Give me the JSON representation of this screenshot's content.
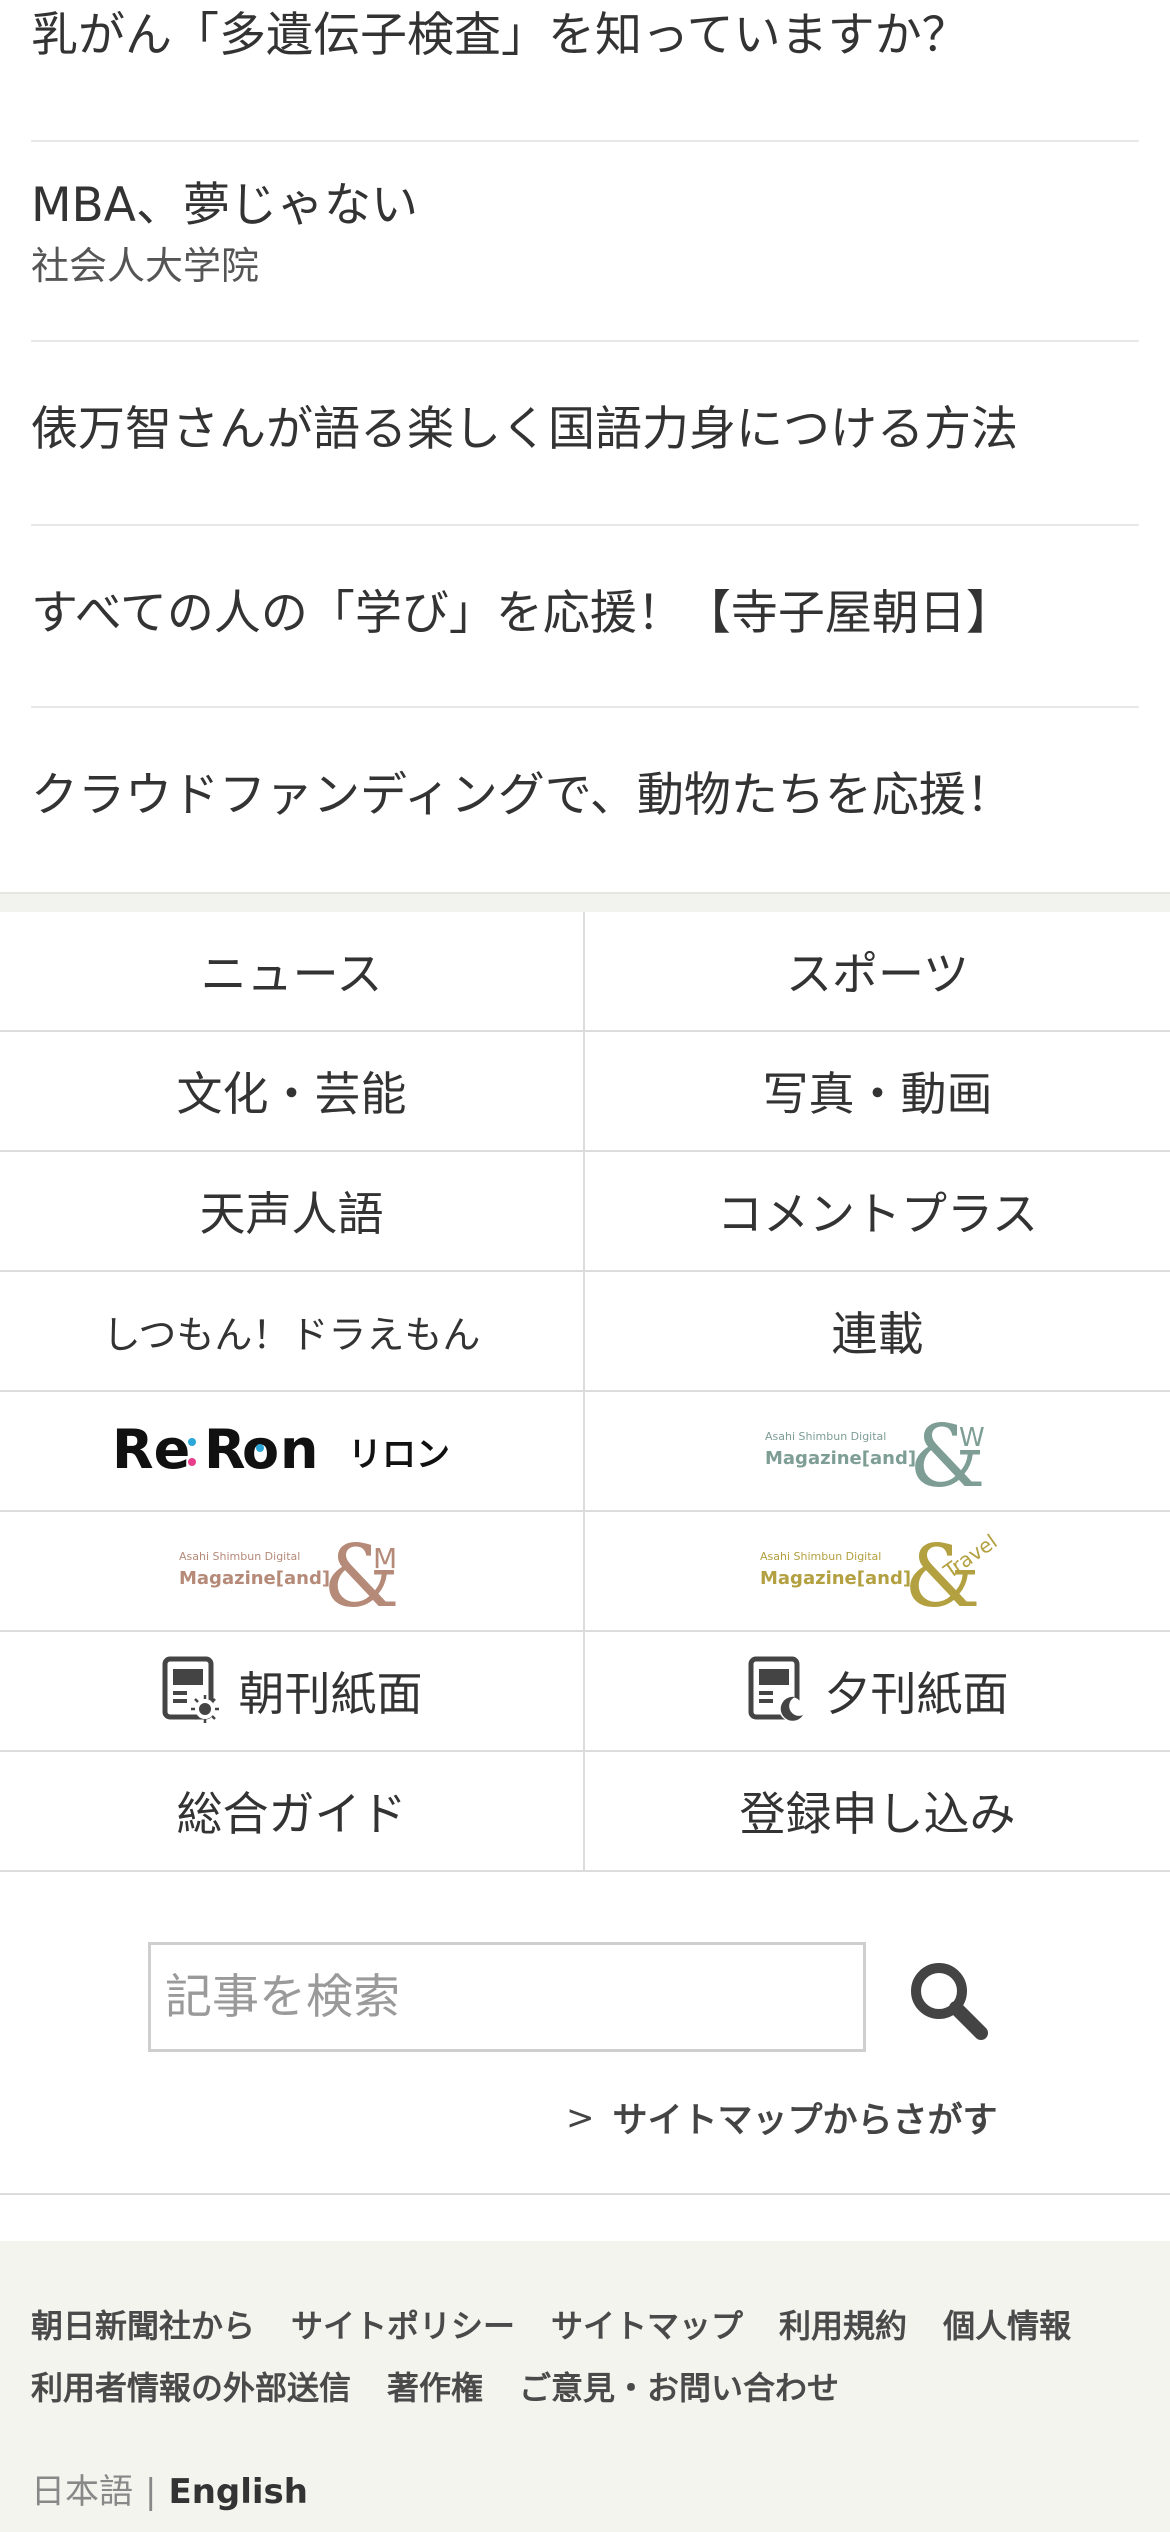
{
  "promos": [
    {
      "title": "乳がん「多遺伝子検査」を知っていますか？"
    },
    {
      "title": "MBA、夢じゃない",
      "subtitle": "社会人大学院"
    },
    {
      "title": "俵万智さんが語る楽しく国語力身につける方法"
    },
    {
      "title": "すべての人の「学び」を応援！【寺子屋朝日】"
    },
    {
      "title": "クラウドファンディングで、動物たちを応援！"
    }
  ],
  "grid": {
    "news": "ニュース",
    "sports": "スポーツ",
    "culture": "文化・芸能",
    "photo_video": "写真・動画",
    "tenseijingo": "天声人語",
    "comment_plus": "コメントプラス",
    "doraemon": "しつもん！ドラえもん",
    "serial": "連載",
    "reron_logo": "Re:Ron リロン",
    "andw_logo": {
      "top": "Asahi Shimbun Digital",
      "main": "Magazine[and]",
      "mark": "&W"
    },
    "andm_logo": {
      "top": "Asahi Shimbun Digital",
      "main": "Magazine[and]",
      "mark": "&M"
    },
    "andtravel_logo": {
      "top": "Asahi Shimbun Digital",
      "main": "Magazine[and]",
      "mark": "&Travel"
    },
    "morning_edition": "朝刊紙面",
    "evening_edition": "夕刊紙面",
    "guide": "総合ガイド",
    "register": "登録申し込み"
  },
  "search": {
    "placeholder": "記事を検索",
    "sitemap_link": "サイトマップからさがす"
  },
  "footer": {
    "row1": [
      "朝日新聞社から",
      "サイトポリシー",
      "サイトマップ",
      "利用規約",
      "個人情報"
    ],
    "row2": [
      "利用者情報の外部送信",
      "著作権",
      "ご意見・お問い合わせ"
    ],
    "lang_ja": "日本語",
    "lang_sep": "|",
    "lang_en": "English"
  },
  "colors": {
    "accent_green": "#7d9d95",
    "accent_brown": "#b58a78",
    "accent_gold": "#b3a040"
  }
}
